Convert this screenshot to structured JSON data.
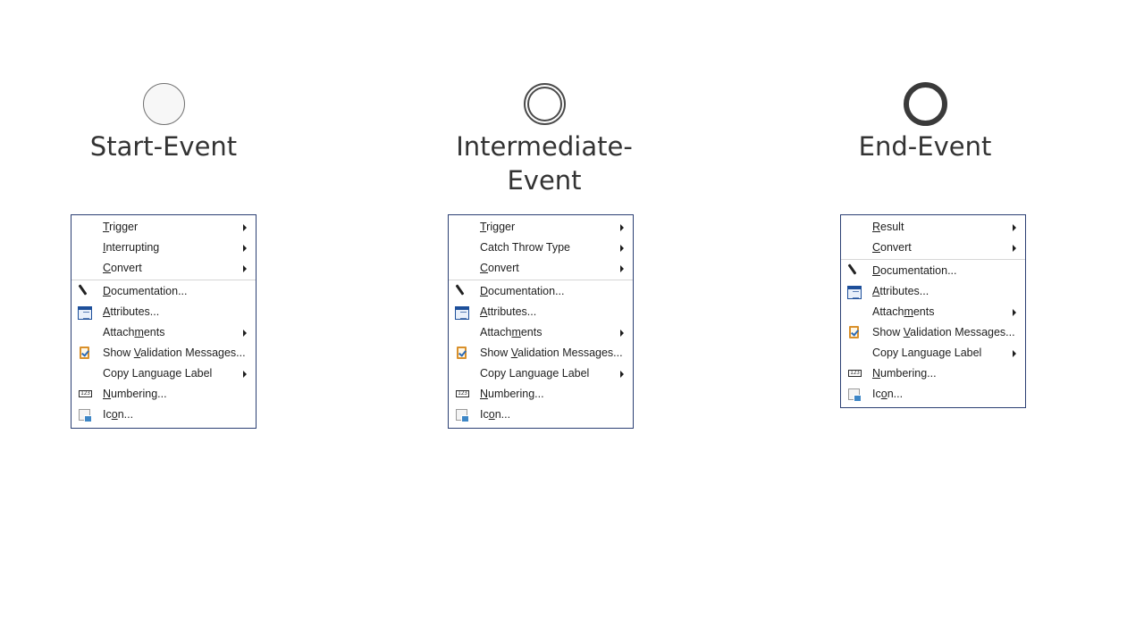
{
  "events": {
    "start": {
      "title": "Start-Event",
      "menu": {
        "trigger": {
          "pre": "",
          "ul": "T",
          "post": "rigger"
        },
        "interrupting": {
          "pre": "",
          "ul": "I",
          "post": "nterrupting"
        },
        "convert": {
          "pre": "",
          "ul": "C",
          "post": "onvert"
        },
        "documentation": {
          "pre": "",
          "ul": "D",
          "post": "ocumentation..."
        },
        "attributes": {
          "pre": "",
          "ul": "A",
          "post": "ttributes..."
        },
        "attachments": {
          "pre": "Attach",
          "ul": "m",
          "post": "ents"
        },
        "validation": {
          "pre": "Show ",
          "ul": "V",
          "post": "alidation Messages..."
        },
        "copy_language": {
          "pre": "Copy Language Label",
          "ul": "",
          "post": ""
        },
        "numbering": {
          "pre": "",
          "ul": "N",
          "post": "umbering..."
        },
        "icon": {
          "pre": "Ic",
          "ul": "o",
          "post": "n..."
        }
      }
    },
    "intermediate": {
      "title": "Intermediate-Event",
      "menu": {
        "trigger": {
          "pre": "",
          "ul": "T",
          "post": "rigger"
        },
        "catch_throw": {
          "pre": "Catch Throw Type",
          "ul": "",
          "post": ""
        },
        "convert": {
          "pre": "",
          "ul": "C",
          "post": "onvert"
        },
        "documentation": {
          "pre": "",
          "ul": "D",
          "post": "ocumentation..."
        },
        "attributes": {
          "pre": "",
          "ul": "A",
          "post": "ttributes..."
        },
        "attachments": {
          "pre": "Attach",
          "ul": "m",
          "post": "ents"
        },
        "validation": {
          "pre": "Show ",
          "ul": "V",
          "post": "alidation Messages..."
        },
        "copy_language": {
          "pre": "Copy Language Label",
          "ul": "",
          "post": ""
        },
        "numbering": {
          "pre": "",
          "ul": "N",
          "post": "umbering..."
        },
        "icon": {
          "pre": "Ic",
          "ul": "o",
          "post": "n..."
        }
      }
    },
    "end": {
      "title": "End-Event",
      "menu": {
        "result": {
          "pre": "",
          "ul": "R",
          "post": "esult"
        },
        "convert": {
          "pre": "",
          "ul": "C",
          "post": "onvert"
        },
        "documentation": {
          "pre": "",
          "ul": "D",
          "post": "ocumentation..."
        },
        "attributes": {
          "pre": "",
          "ul": "A",
          "post": "ttributes..."
        },
        "attachments": {
          "pre": "Attach",
          "ul": "m",
          "post": "ents"
        },
        "validation": {
          "pre": "Show ",
          "ul": "V",
          "post": "alidation Messages..."
        },
        "copy_language": {
          "pre": "Copy Language Label",
          "ul": "",
          "post": ""
        },
        "numbering": {
          "pre": "",
          "ul": "N",
          "post": "umbering..."
        },
        "icon": {
          "pre": "Ic",
          "ul": "o",
          "post": "n..."
        }
      }
    }
  },
  "icons": {
    "documentation": "pencil-icon",
    "attributes": "attributes-icon",
    "validation": "clipboard-check-icon",
    "numbering": "numbering-icon",
    "icon": "image-icon",
    "submenu": "chevron-right-icon"
  },
  "numbering_icon_glyph": "123",
  "colors": {
    "menu_border": "#2b3f73",
    "separator": "#d6d6d6",
    "text": "#1e1e1e",
    "title": "#333333"
  }
}
